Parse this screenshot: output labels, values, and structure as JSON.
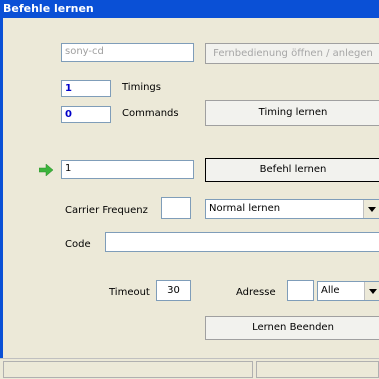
{
  "window": {
    "title": "Befehle lernen"
  },
  "remote": {
    "name_value": "sony-cd",
    "open_button": "Fernbedienung öffnen / anlegen"
  },
  "timings": {
    "value": "1",
    "label": "Timings"
  },
  "commands": {
    "value": "0",
    "label": "Commands"
  },
  "timing_button": "Timing lernen",
  "command_input": {
    "value": "1"
  },
  "learn_button": "Befehl lernen",
  "carrier": {
    "label": "Carrier Frequenz",
    "value": ""
  },
  "mode_select": {
    "value": "Normal lernen"
  },
  "code": {
    "label": "Code",
    "value": ""
  },
  "timeout": {
    "label": "Timeout",
    "value": "30"
  },
  "address": {
    "label": "Adresse",
    "value": "",
    "select_value": "Alle"
  },
  "finish_button": "Lernen Beenden",
  "colors": {
    "titlebar": "#0a50d6",
    "panel": "#ece9d8",
    "arrow": "#3cb43c"
  },
  "icons": {
    "current_arrow": "green-arrow-icon"
  }
}
